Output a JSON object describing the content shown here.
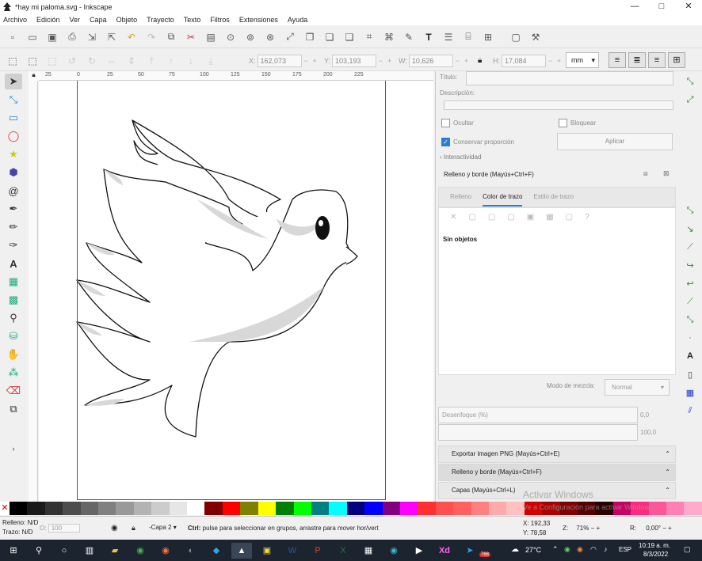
{
  "window": {
    "title": "*hay mi paloma.svg - Inkscape",
    "minimize": "—",
    "maximize": "□",
    "close": "✕"
  },
  "menu": [
    "Archivo",
    "Edición",
    "Ver",
    "Capa",
    "Objeto",
    "Trayecto",
    "Texto",
    "Filtros",
    "Extensiones",
    "Ayuda"
  ],
  "coords": {
    "x_label": "X:",
    "x_value": "162,073",
    "y_label": "Y:",
    "y_value": "103,193",
    "w_label": "W:",
    "w_value": "10,626",
    "h_label": "H:",
    "h_value": "17,084",
    "unit": "mm"
  },
  "ruler": {
    "top_labels": [
      "25",
      "0",
      "25",
      "50",
      "75",
      "100",
      "125",
      "150",
      "175",
      "200",
      "225"
    ]
  },
  "object_props": {
    "title_label": "Título:",
    "description_label": "Descripción:",
    "hidden_label": "Ocultar",
    "lock_label": "Bloquear",
    "keep_ratio_label": "Conservar proporción",
    "apply_label": "Aplicar",
    "interactivity_label": "Interactividad",
    "expand_icon": "›"
  },
  "fill_stroke": {
    "header": "Relleno y borde (Mayús+Ctrl+F)",
    "tab_fill": "Relleno",
    "tab_stroke_paint": "Color de trazo",
    "tab_stroke_style": "Estilo de trazo",
    "no_objects": "Sin objetos",
    "blend_label": "Modo de mezcla:",
    "blend_value": "Normal",
    "blur_label": "Desenfoque (%)",
    "blur_value": "0,0",
    "opacity_value": "100,0"
  },
  "dialogs": [
    {
      "label": "Exportar imagen PNG (Mayús+Ctrl+E)"
    },
    {
      "label": "Relleno y borde (Mayús+Ctrl+F)"
    },
    {
      "label": "Capas (Mayús+Ctrl+L)"
    }
  ],
  "status": {
    "fill_label": "Relleno:",
    "fill_value": "N/D",
    "stroke_label": "Trazo:",
    "stroke_value": "N/D",
    "o_label": "O:",
    "o_value": "100",
    "layer": "-Capa 2",
    "message_bold": "Ctrl:",
    "message": " pulse para seleccionar en grupos, arrastre para mover hor/vert",
    "x_label": "X:",
    "x_value": "192,33",
    "y_label": "Y:",
    "y_value": "78,58",
    "zoom_label": "Z:",
    "zoom_value": "71%",
    "rotation_label": "R:",
    "rotation_value": "0,00°"
  },
  "watermark": {
    "line1": "Activar Windows",
    "line2": "Ve a Configuración para activar Windows."
  },
  "taskbar": {
    "weather": "27°C",
    "time": "10:19 a. m.",
    "date": "8/3/2022",
    "lang": "ESP",
    "badge": "768"
  },
  "palette": [
    "#000000",
    "#1a1a1a",
    "#333333",
    "#4d4d4d",
    "#666666",
    "#808080",
    "#999999",
    "#b3b3b3",
    "#cccccc",
    "#e6e6e6",
    "#ffffff",
    "#800000",
    "#ff0000",
    "#808000",
    "#ffff00",
    "#008000",
    "#00ff00",
    "#008080",
    "#00ffff",
    "#000080",
    "#0000ff",
    "#800080",
    "#ff00ff",
    "#ff3030",
    "#ff5050",
    "#ff6060",
    "#ff8080",
    "#ffaaaa",
    "#ffc0c0",
    "#d40000",
    "#aa0000",
    "#800000",
    "#550000",
    "#2b0000",
    "#c80064",
    "#ff2a7f",
    "#ff5599",
    "#ff80b2",
    "#ffaacc"
  ]
}
